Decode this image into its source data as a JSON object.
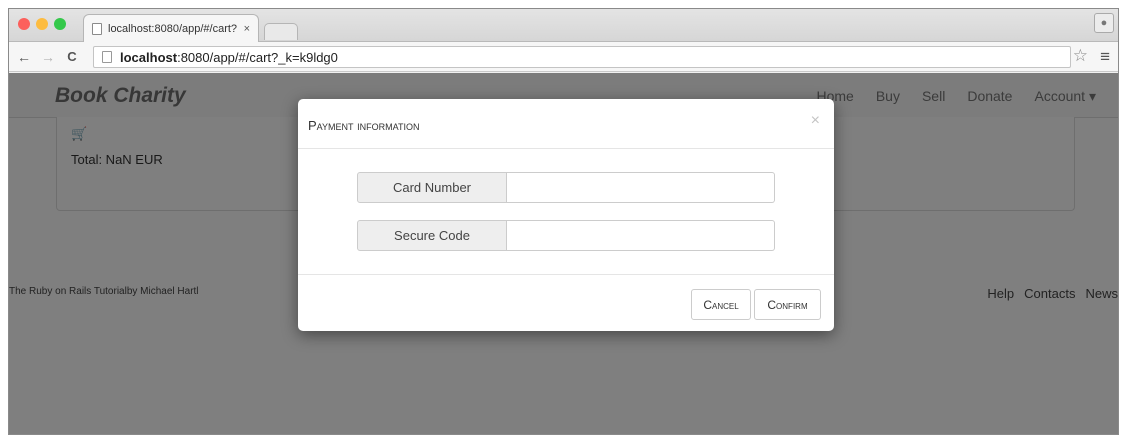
{
  "browser": {
    "tab_title": "localhost:8080/app/#/cart?",
    "tab_close": "×",
    "url_host": "localhost",
    "url_rest": ":8080/app/#/cart?_k=k9ldg0",
    "back_glyph": "←",
    "forward_glyph": "→",
    "reload_glyph": "C",
    "star_glyph": "☆",
    "menu_glyph": "≡",
    "profile_glyph": "●",
    "traffic_lights": [
      "#fc605c",
      "#fdbc40",
      "#34c84a"
    ]
  },
  "navbar": {
    "brand": "Book Charity",
    "links": [
      "Home",
      "Buy",
      "Sell",
      "Donate",
      "Account ▾"
    ]
  },
  "cart": {
    "cart_icon": "🛒",
    "total": "Total: NaN EUR"
  },
  "footer": {
    "left": "The Ruby on Rails Tutorialby Michael Hartl",
    "links": [
      "Help",
      "Contacts",
      "News"
    ]
  },
  "modal": {
    "title": "Payment information",
    "close": "×",
    "fields": [
      {
        "label": "Card Number",
        "value": ""
      },
      {
        "label": "Secure Code",
        "value": ""
      }
    ],
    "cancel_label": "Cancel",
    "confirm_label": "Confirm"
  }
}
